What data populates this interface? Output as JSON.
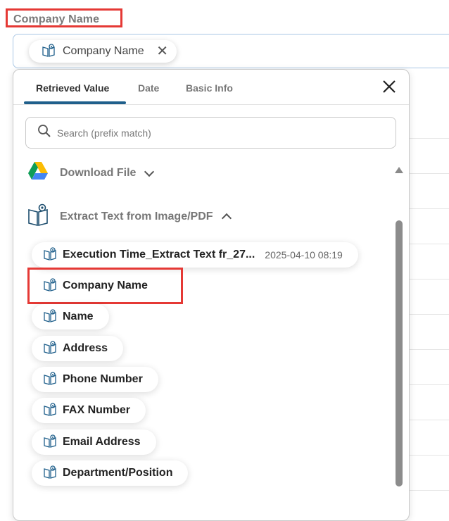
{
  "field": {
    "label": "Company Name"
  },
  "selected_value": {
    "label": "Company Name",
    "icon": "book-eye-icon",
    "remove_icon": "close-icon"
  },
  "dropdown": {
    "tabs": [
      {
        "label": "Retrieved Value",
        "active": true
      },
      {
        "label": "Date",
        "active": false
      },
      {
        "label": "Basic Info",
        "active": false
      }
    ],
    "close_icon": "close-icon",
    "search": {
      "placeholder": "Search (prefix match)",
      "icon": "search-icon"
    },
    "sections": [
      {
        "label": "Download File",
        "icon": "google-drive-icon",
        "expanded": false
      },
      {
        "label": "Extract Text from Image/PDF",
        "icon": "book-eye-icon",
        "expanded": true
      }
    ],
    "items": [
      {
        "label": "Execution Time_Extract Text fr_27...",
        "meta": "2025-04-10 08:19"
      },
      {
        "label": "Company Name",
        "highlighted": true
      },
      {
        "label": "Name"
      },
      {
        "label": "Address"
      },
      {
        "label": "Phone Number"
      },
      {
        "label": "FAX Number"
      },
      {
        "label": "Email Address"
      },
      {
        "label": "Department/Position"
      }
    ]
  },
  "colors": {
    "accent": "#1f5f8b",
    "highlight": "#e53935"
  }
}
